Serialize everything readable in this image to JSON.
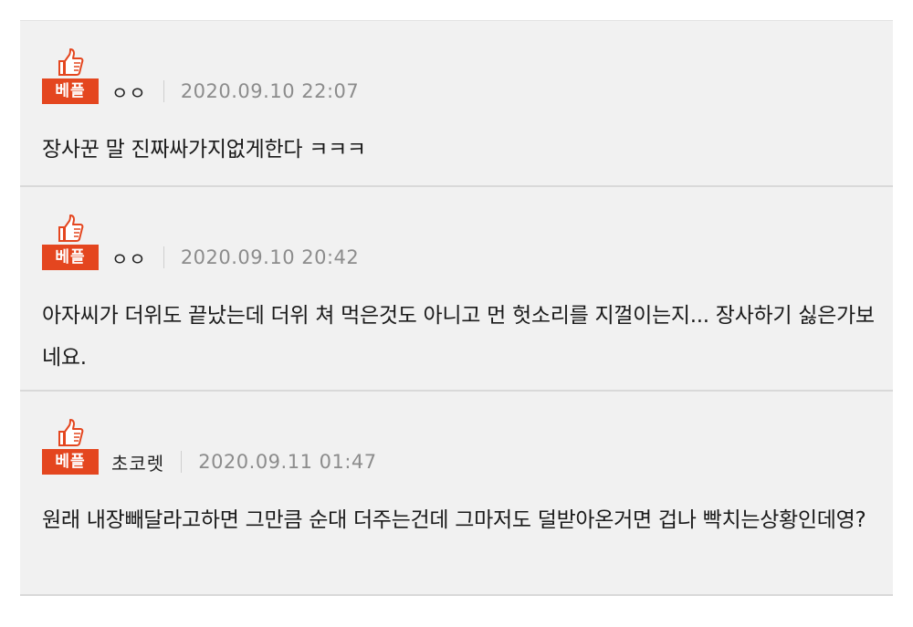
{
  "comments": [
    {
      "badge_label": "베플",
      "author": "ㅇㅇ",
      "date": "2020.09.10 22:07",
      "text": "장사꾼 말 진짜싸가지없게한다 ㅋㅋㅋ"
    },
    {
      "badge_label": "베플",
      "author": "ㅇㅇ",
      "date": "2020.09.10 20:42",
      "text": "아자씨가 더위도 끝났는데 더위 쳐 먹은것도 아니고 먼 헛소리를 지껄이는지... 장사하기 싫은가보네요."
    },
    {
      "badge_label": "베플",
      "author": "초코렛",
      "date": "2020.09.11 01:47",
      "text": "원래 내장빼달라고하면 그만큼 순대 더주는건데 그마저도 덜받아온거면 겁나 빡치는상황인데영?"
    }
  ],
  "colors": {
    "badge_bg": "#e4461f",
    "card_bg": "#f1f1f1",
    "date_text": "#8c8c8c"
  },
  "icons": {
    "badge_icon": "thumbs-up-icon"
  }
}
